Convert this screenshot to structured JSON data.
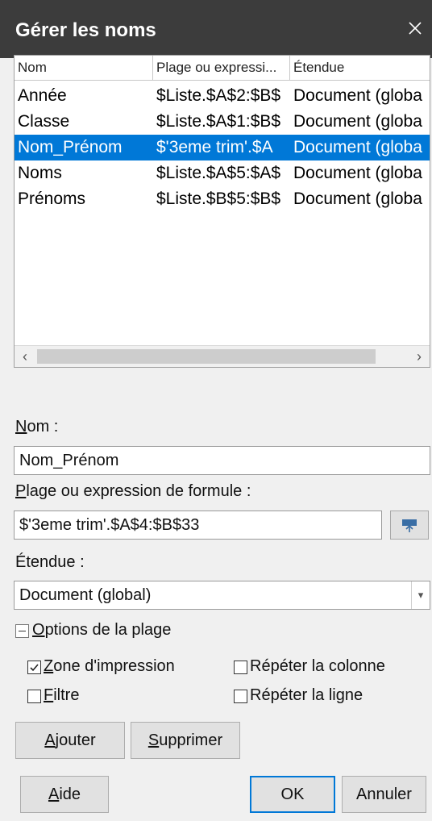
{
  "window": {
    "title": "Gérer les noms"
  },
  "table": {
    "columns": [
      "Nom",
      "Plage ou expressi...",
      "Étendue"
    ],
    "rows": [
      {
        "name": "Année",
        "range": "$Liste.$A$2:$B$",
        "scope": "Document (globa"
      },
      {
        "name": "Classe",
        "range": "$Liste.$A$1:$B$",
        "scope": "Document (globa"
      },
      {
        "name": "Nom_Prénom",
        "range": "$'3eme trim'.$A",
        "scope": "Document (globa"
      },
      {
        "name": "Noms",
        "range": "$Liste.$A$5:$A$",
        "scope": "Document (globa"
      },
      {
        "name": "Prénoms",
        "range": "$Liste.$B$5:$B$",
        "scope": "Document (globa"
      }
    ],
    "selected_index": 2
  },
  "form": {
    "name_label": "Nom :",
    "name_value": "Nom_Prénom",
    "range_label": "Plage ou expression de formule :",
    "range_value": "$'3eme trim'.$A$4:$B$33",
    "scope_label": "Étendue :",
    "scope_value": "Document (global)"
  },
  "options": {
    "section_label": "Options de la plage",
    "print_area": {
      "label": "Zone d'impression",
      "checked": true
    },
    "repeat_column": {
      "label": "Répéter la colonne",
      "checked": false
    },
    "filter": {
      "label": "Filtre",
      "checked": false
    },
    "repeat_row": {
      "label": "Répéter la ligne",
      "checked": false
    }
  },
  "buttons": {
    "add": "Ajouter",
    "delete": "Supprimer",
    "help": "Aide",
    "ok": "OK",
    "cancel": "Annuler"
  },
  "colors": {
    "selection": "#0078d7",
    "titlebar": "#3c3c3c"
  }
}
